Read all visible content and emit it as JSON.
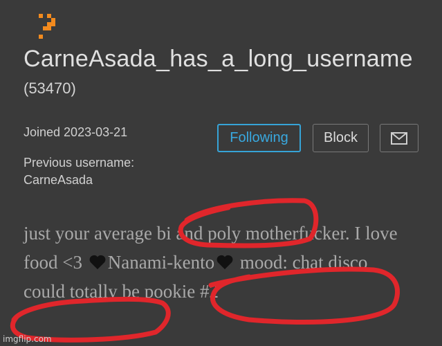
{
  "profile": {
    "username": "CarneAsada_has_a_long_username",
    "user_id": "(53470)",
    "joined": "Joined 2023-03-21",
    "previous_username_label": "Previous username:",
    "previous_username": "CarneAsada"
  },
  "actions": {
    "following_label": "Following",
    "block_label": "Block",
    "message_icon": "envelope-icon"
  },
  "bio": {
    "part1": "just your average bi and poly motherfucker. I love food <3 ",
    "part2": "Nanami-kento",
    "part3": " mood: chat disco could totally be pookie #2",
    "emoji": "black-heart-icon"
  },
  "overlay": {
    "watermark": "imgflip.com",
    "scribble_color": "#e0262b"
  },
  "colors": {
    "background": "#3a3a3a",
    "accent": "#36a4d8",
    "logo": "#f28a1e"
  }
}
